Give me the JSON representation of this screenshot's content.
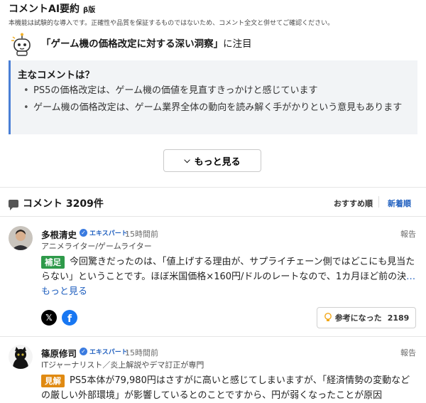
{
  "ai_summary": {
    "title": "コメントAI要約",
    "beta_label": "β版",
    "notice": "本機能は試験的な導入です。正確性や品質を保証するものではないため、コメント全文と併せてご確認ください。",
    "topic_quoted": "「ゲーム機の価格改定に対する深い洞察」",
    "topic_suffix": "に注目",
    "main_heading": "主なコメントは？",
    "points": [
      "PS5の価格改定は、ゲーム機の価値を見直すきっかけと感じています",
      "ゲーム機の価格改定は、ゲーム業界全体の動向を読み解く手がかりという意見もあります"
    ],
    "more_label": "もっと見る"
  },
  "comments_section": {
    "title": "コメント 3209件",
    "sort_recommended": "おすすめ順",
    "sort_newest": "新着順",
    "active_sort": "新着順"
  },
  "comments": [
    {
      "name": "多根清史",
      "badge": "エキスパート",
      "time": "15時間前",
      "report": "報告",
      "role": "アニメライター/ゲームライター",
      "tag": "補足",
      "tag_color": "#2e9a4a",
      "text": "今回驚きだったのは、「値上げする理由が、サプライチェーン側ではどこにも見当たらない」ということです。ほぼ米国価格×160円/ドルのレートなので、1カ月ほど前の決",
      "more": "…もっと見る",
      "helpful_label": "参考になった",
      "helpful_count": "2189"
    },
    {
      "name": "篠原修司",
      "badge": "エキスパート",
      "time": "15時間前",
      "report": "報告",
      "role": "ITジャーナリスト／炎上解説やデマ訂正が専門",
      "tag": "見解",
      "tag_color": "#e08a12",
      "text": "PS5本体が79,980円はさすがに高いと感じてしまいますが、「経済情勢の変動などの厳しい外部環境」が影響しているとのことですから、円が弱くなったことが原因"
    }
  ],
  "colors": {
    "accent_blue": "#1f5fbf",
    "summary_bar": "#4a7fd6",
    "facebook": "#1877f2"
  },
  "icons": [
    "ai-robot-icon",
    "comment-icon",
    "verified-check-icon",
    "x-share-icon",
    "facebook-share-icon",
    "lightbulb-icon",
    "chevron-down-icon"
  ]
}
